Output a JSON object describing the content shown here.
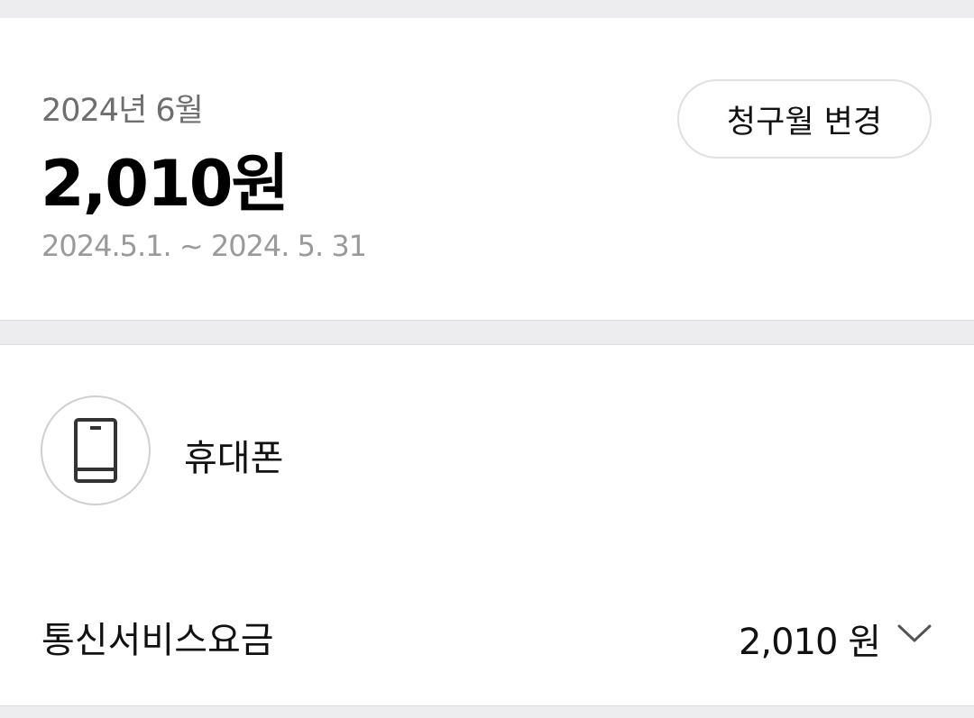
{
  "summary": {
    "billing_month": "2024년 6월",
    "total_amount": "2,010원",
    "period": "2024.5.1. ~ 2024. 5. 31",
    "change_month_button": "청구월 변경"
  },
  "detail": {
    "device": {
      "icon": "mobile-phone-icon",
      "label": "휴대폰"
    },
    "fee": {
      "label": "통신서비스요금",
      "amount": "2,010 원",
      "expand_icon": "chevron-down-icon"
    }
  },
  "colors": {
    "background": "#ededef",
    "card": "#ffffff",
    "primary_text": "#111111",
    "secondary_text": "#6e6e6e",
    "muted_text": "#9a9a9a"
  }
}
